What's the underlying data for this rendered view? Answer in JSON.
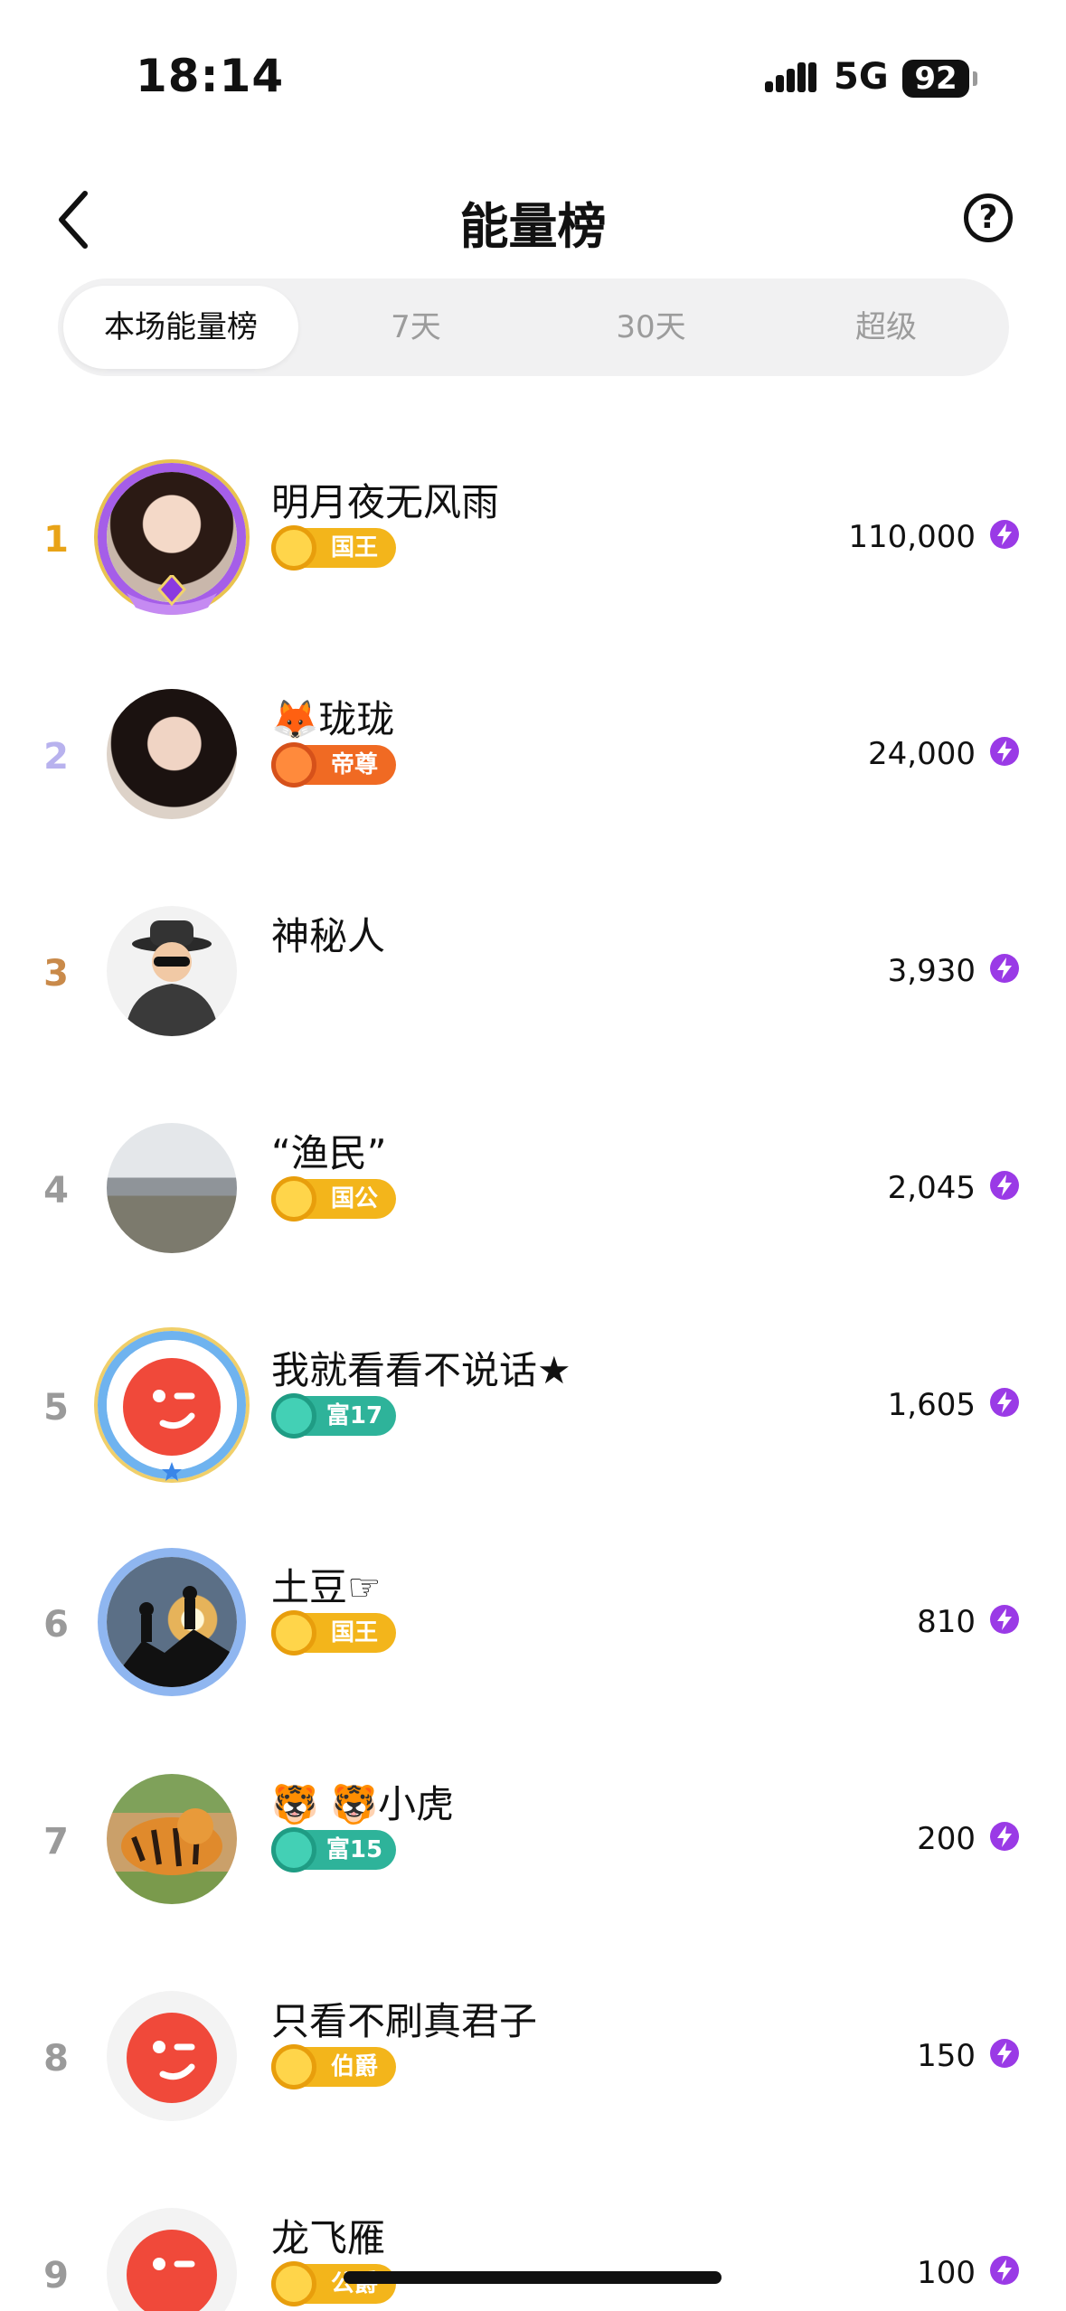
{
  "status_bar": {
    "time": "18:14",
    "network": "5G",
    "battery": "92"
  },
  "header": {
    "title": "能量榜",
    "help_label": "?"
  },
  "tabs": [
    {
      "label": "本场能量榜",
      "active": true
    },
    {
      "label": "7天",
      "active": false
    },
    {
      "label": "30天",
      "active": false
    },
    {
      "label": "超级",
      "active": false
    }
  ],
  "ranking": [
    {
      "rank": "1",
      "name": "明月夜无风雨",
      "badge": "国王",
      "score": "110,000",
      "avatar": "woman-portrait",
      "frame": "purple-crest-frame"
    },
    {
      "rank": "2",
      "name": "🦊珑珑",
      "badge": "帝尊",
      "score": "24,000",
      "avatar": "woman-portrait"
    },
    {
      "rank": "3",
      "name": "神秘人",
      "badge": "",
      "score": "3,930",
      "avatar": "mystery-man"
    },
    {
      "rank": "4",
      "name": "“渔民”",
      "badge": "国公",
      "score": "2,045",
      "avatar": "harbor-photo"
    },
    {
      "rank": "5",
      "name": "我就看看不说话★",
      "badge": "富17",
      "score": "1,605",
      "avatar": "red-wink-logo",
      "frame": "blue-gold-frame"
    },
    {
      "rank": "6",
      "name": "土豆☞",
      "badge": "国王",
      "score": "810",
      "avatar": "climbers-silhouette",
      "frame": "blue-ring-frame"
    },
    {
      "rank": "7",
      "name": "🐯 🐯小虎",
      "badge": "富15",
      "score": "200",
      "avatar": "tiger-photo"
    },
    {
      "rank": "8",
      "name": "只看不刷真君子",
      "badge": "伯爵",
      "score": "150",
      "avatar": "red-wink-logo"
    },
    {
      "rank": "9",
      "name": "龙飞雁",
      "badge": "公爵",
      "score": "100",
      "avatar": "red-wink-logo"
    }
  ],
  "colors": {
    "rank_1": "#e8a317",
    "rank_2": "#b8b2ee",
    "rank_3": "#c98a4a",
    "rank_other": "#9a9a9a",
    "badge_gold": "#f3b51b",
    "badge_orange": "#f06a23",
    "badge_teal": "#2eb39a",
    "energy": "#9a3ae6"
  },
  "icons": {
    "back": "chevron-left-icon",
    "help": "question-circle-icon",
    "energy": "lightning-bolt-icon"
  }
}
